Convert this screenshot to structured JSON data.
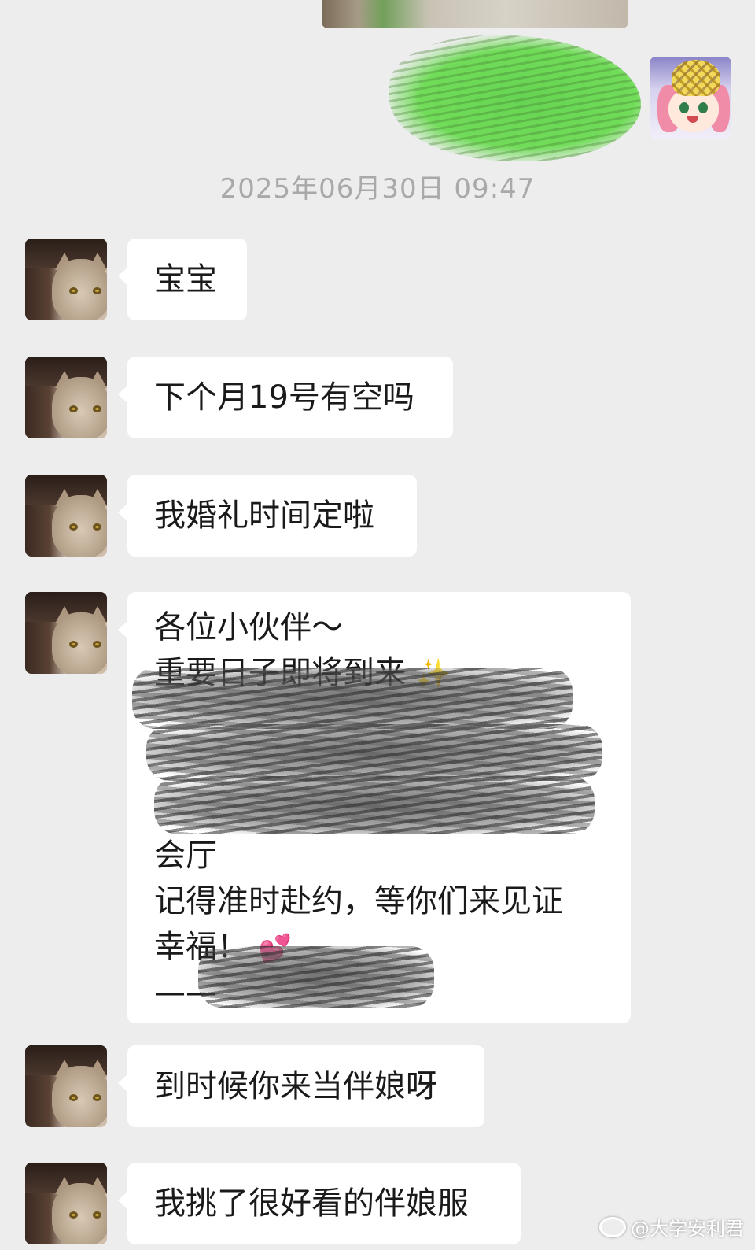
{
  "timestamp": "2025年06月30日 09:47",
  "messages": [
    {
      "text": "宝宝"
    },
    {
      "text": "下个月19号有空吗"
    },
    {
      "text": "我婚礼时间定啦"
    },
    {
      "lines": [
        "各位小伙伴～",
        "重要日子即将到来",
        "会厅",
        "记得准时赴约，等你们来见证",
        "幸福！",
        "——"
      ]
    },
    {
      "text": "到时候你来当伴娘呀"
    },
    {
      "text": "我挑了很好看的伴娘服"
    }
  ],
  "watermark": "@大学安利君",
  "icons": {
    "sparkle": "✨",
    "hearts": "💕",
    "weibo": "weibo-icon"
  },
  "colors": {
    "background": "#ededed",
    "bubble": "#ffffff",
    "timestamp": "#a9a9a9"
  }
}
